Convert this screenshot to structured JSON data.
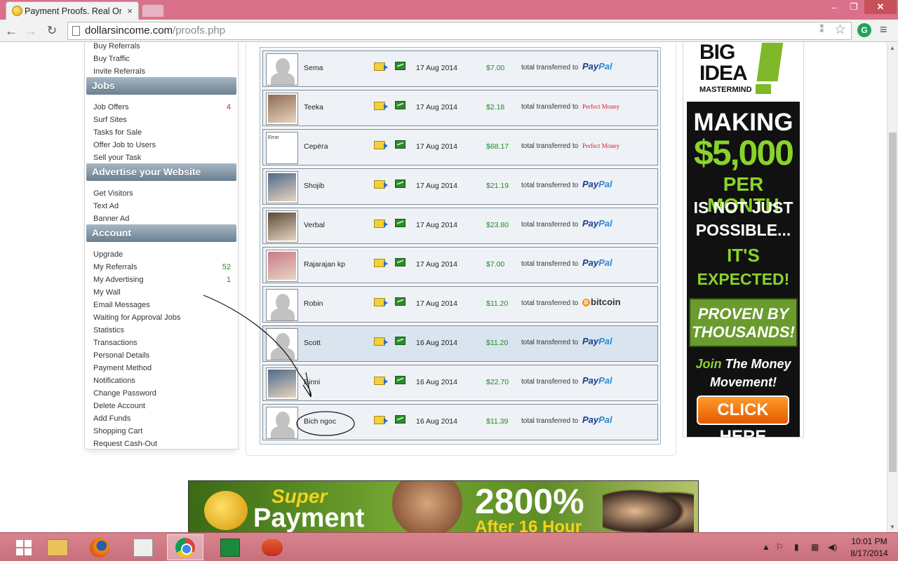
{
  "browser": {
    "tab_title": "Payment Proofs. Real Onli",
    "tab_close": "×",
    "url_host": "dollarsincome.com",
    "url_path": "/proofs.php",
    "window_min": "‒",
    "window_max": "❐",
    "window_close": "✕",
    "back": "←",
    "forward": "→",
    "reload": "↻",
    "star": "☆",
    "menu": "≡",
    "translate": "⁑",
    "extension": "G"
  },
  "sidebar": {
    "top_links": [
      {
        "label": "Buy Referrals"
      },
      {
        "label": "Buy Traffic"
      },
      {
        "label": "Invite Referrals"
      }
    ],
    "jobs": {
      "heading": "Jobs",
      "items": [
        {
          "label": "Job Offers",
          "count": "4"
        },
        {
          "label": "Surf Sites"
        },
        {
          "label": "Tasks for Sale"
        },
        {
          "label": "Offer Job to Users"
        },
        {
          "label": "Sell your Task"
        }
      ]
    },
    "advertise": {
      "heading": "Advertise your Website",
      "items": [
        {
          "label": "Get Visitors"
        },
        {
          "label": "Text Ad"
        },
        {
          "label": "Banner Ad"
        }
      ]
    },
    "account": {
      "heading": "Account",
      "items": [
        {
          "label": "Upgrade"
        },
        {
          "label": "My Referrals",
          "count": "52"
        },
        {
          "label": "My Advertising",
          "count": "1"
        },
        {
          "label": "My Wall"
        },
        {
          "label": "Email Messages"
        },
        {
          "label": "Waiting for Approval Jobs"
        },
        {
          "label": "Statistics"
        },
        {
          "label": "Transactions"
        },
        {
          "label": "Personal Details"
        },
        {
          "label": "Payment Method"
        },
        {
          "label": "Notifications"
        },
        {
          "label": "Change Password"
        },
        {
          "label": "Delete Account"
        },
        {
          "label": "Add Funds"
        },
        {
          "label": "Shopping Cart"
        },
        {
          "label": "Request Cash-Out"
        }
      ]
    }
  },
  "proofs": {
    "transfer_label": "total transferred to",
    "rows": [
      {
        "name": "Sema",
        "date": "17 Aug 2014",
        "amount": "$7.00",
        "gateway": "paypal",
        "avatar": "placeholder-female"
      },
      {
        "name": "Teeka",
        "date": "17 Aug 2014",
        "amount": "$2.18",
        "gateway": "perfectmoney",
        "avatar": "photo"
      },
      {
        "name": "Серёга",
        "date": "17 Aug 2014",
        "amount": "$68.17",
        "gateway": "perfectmoney",
        "avatar": "error"
      },
      {
        "name": "Shojib",
        "date": "17 Aug 2014",
        "amount": "$21.19",
        "gateway": "paypal",
        "avatar": "photo"
      },
      {
        "name": "Verbal",
        "date": "17 Aug 2014",
        "amount": "$23.80",
        "gateway": "paypal",
        "avatar": "photo"
      },
      {
        "name": "Rajarajan kp",
        "date": "17 Aug 2014",
        "amount": "$7.00",
        "gateway": "paypal",
        "avatar": "photo"
      },
      {
        "name": "Robin",
        "date": "17 Aug 2014",
        "amount": "$11.20",
        "gateway": "bitcoin",
        "avatar": "placeholder-male"
      },
      {
        "name": "Scott",
        "date": "16 Aug 2014",
        "amount": "$11.20",
        "gateway": "paypal",
        "avatar": "placeholder-male",
        "highlight": true
      },
      {
        "name": "Binni",
        "date": "16 Aug 2014",
        "amount": "$22.70",
        "gateway": "paypal",
        "avatar": "photo"
      },
      {
        "name": "Bich ngoc",
        "date": "16 Aug 2014",
        "amount": "$11.39",
        "gateway": "paypal",
        "avatar": "placeholder-female"
      }
    ],
    "gateway_labels": {
      "paypal_a": "Pay",
      "paypal_b": "Pal",
      "perfectmoney": "Perfect Money",
      "bitcoin": "bitcoin",
      "bitcoin_symbol": "B"
    },
    "avatar_error_text": "Error"
  },
  "right_ad": {
    "big": "BIG",
    "idea": "IDEA",
    "mastermind": "MASTERMIND",
    "making": "MAKING",
    "amount": "$5,000",
    "per_month": "PER MONTH",
    "not_just": "IS NOT JUST",
    "possible": "POSSIBLE...",
    "its": "IT'S",
    "expected": "EXPECTED!",
    "proven_1": "PROVEN BY",
    "proven_2": "THOUSANDS!",
    "join_word": "Join",
    "join_rest": "The Money",
    "movement": "Movement!",
    "click_here": "CLICK HERE"
  },
  "bottom_banner": {
    "super": "Super",
    "payment": "Payment",
    "percent": "2800%",
    "after": "After 16 Hour"
  },
  "taskbar": {
    "clock_time": "10:01 PM",
    "clock_date": "8/17/2014",
    "tray_arrow": "▲",
    "tray_flag": "⚐",
    "tray_power": "▮",
    "tray_network": "▦",
    "tray_volume": "◀)"
  },
  "colors": {
    "titlebar": "#d9718a",
    "sidebar_heading": "#6b8092",
    "amount_green": "#1f8b1f",
    "count_red": "#cc2222",
    "paypal_blue": "#1b3d8c"
  }
}
